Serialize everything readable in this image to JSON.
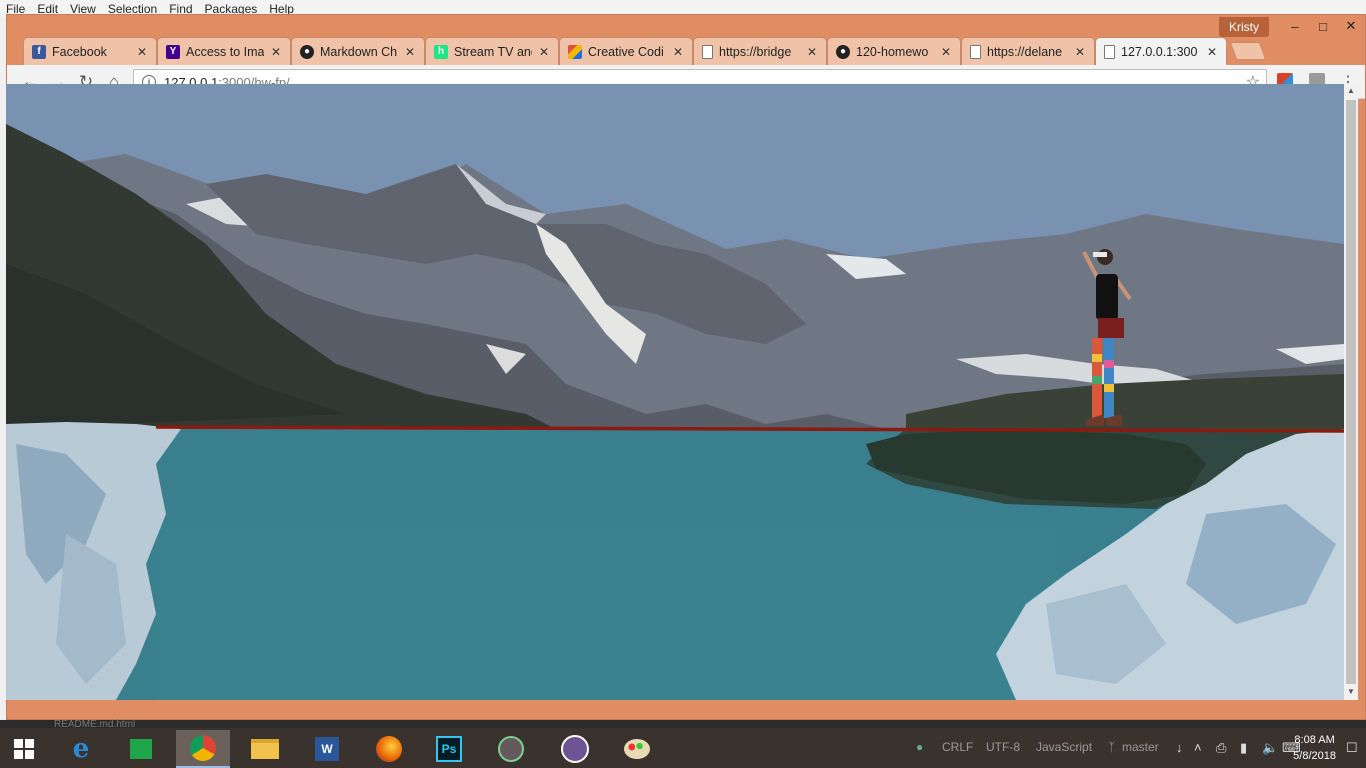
{
  "atom_menu": [
    "File",
    "Edit",
    "View",
    "Selection",
    "Find",
    "Packages",
    "Help"
  ],
  "user": "Kristy",
  "tabs": [
    {
      "title": "Facebook",
      "icon": "facebook-icon",
      "color": "#3b5998",
      "glyph": "f"
    },
    {
      "title": "Access to Ima",
      "icon": "yahoo-icon",
      "color": "#400090",
      "glyph": "Y"
    },
    {
      "title": "Markdown Ch",
      "icon": "github-icon",
      "color": "#222222",
      "glyph": "●"
    },
    {
      "title": "Stream TV and",
      "icon": "hulu-icon",
      "color": "#1ce783",
      "glyph": "h"
    },
    {
      "title": "Creative Codi",
      "icon": "creative-coding-icon",
      "color": "#e04e39",
      "glyph": "◆"
    },
    {
      "title": "https://bridge",
      "icon": "page-icon",
      "color": "#ffffff",
      "glyph": ""
    },
    {
      "title": "120-homewo",
      "icon": "github-icon",
      "color": "#222222",
      "glyph": "●"
    },
    {
      "title": "https://delane",
      "icon": "page-icon",
      "color": "#ffffff",
      "glyph": ""
    },
    {
      "title": "127.0.0.1:300",
      "icon": "page-icon",
      "color": "#ffffff",
      "glyph": ""
    }
  ],
  "url": {
    "host": "127.0.0.1",
    "path": ":3000/hw-fp/"
  },
  "atom_status_file": "README.md.html",
  "status_bar": {
    "line_ending": "CRLF",
    "encoding": "UTF-8",
    "grammar": "JavaScript",
    "branch": "master"
  },
  "clock": {
    "time": "8:08 AM",
    "date": "5/8/2018"
  },
  "colors": {
    "chrome_frame": "#e08d64",
    "sky": "#7a92b2",
    "lake": "#3a7f8e",
    "rope": "#8b1a10"
  }
}
